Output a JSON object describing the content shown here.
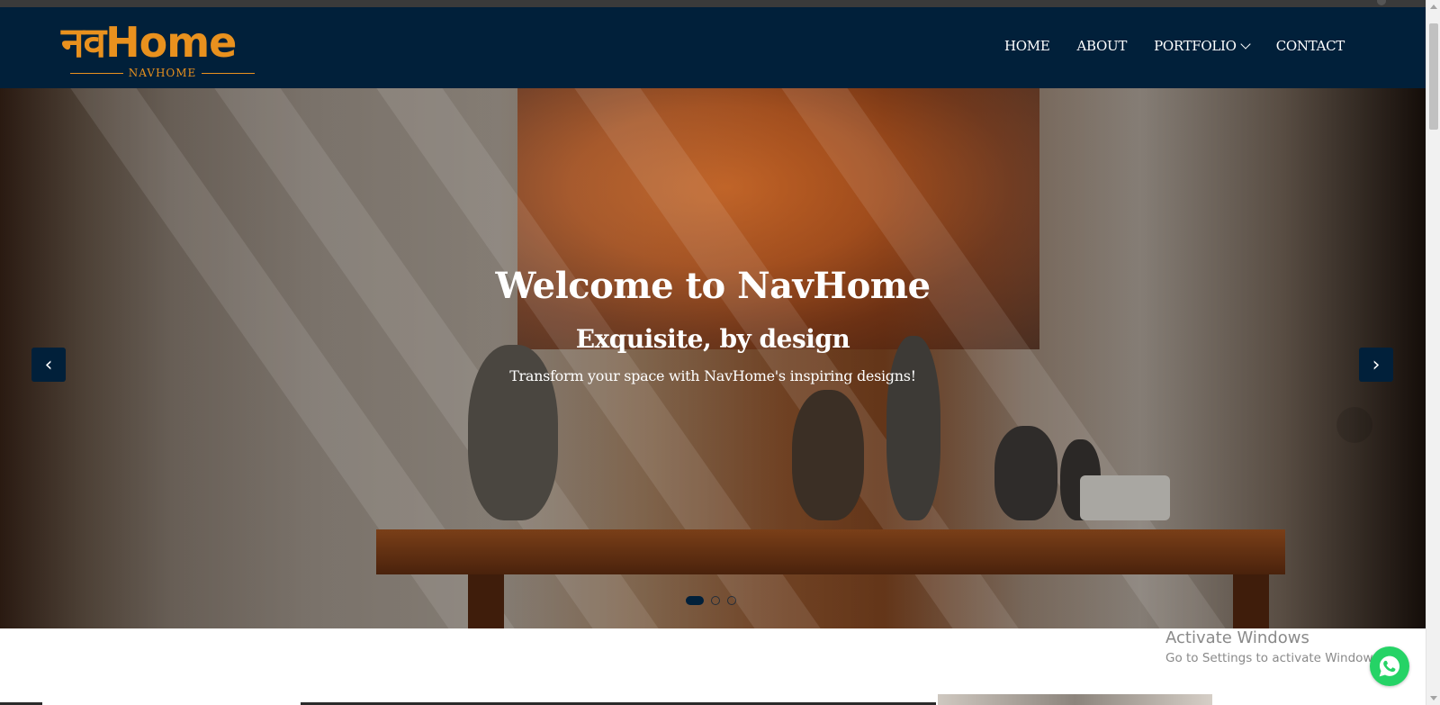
{
  "site": {
    "logo_text": "नवHome",
    "logo_subtext": "NAVHOME"
  },
  "nav": {
    "items": [
      {
        "label": "HOME"
      },
      {
        "label": "ABOUT"
      },
      {
        "label": "PORTFOLIO"
      },
      {
        "label": "CONTACT"
      }
    ]
  },
  "hero": {
    "title": "Welcome to NavHome",
    "subtitle": "Exquisite, by design",
    "text": "Transform your space with NavHome's inspiring designs!",
    "prev_label": "‹",
    "next_label": "›",
    "slides_total": 3,
    "active_slide": 1
  },
  "overlay": {
    "activate_title": "Activate Windows",
    "activate_text": "Go to Settings to activate Windows."
  },
  "icons": {
    "dropdown": "chevron-down-icon",
    "whatsapp": "whatsapp-icon"
  },
  "colors": {
    "navbar_bg": "#01203a",
    "brand_orange": "#e9911e",
    "whatsapp_green": "#25d366"
  }
}
